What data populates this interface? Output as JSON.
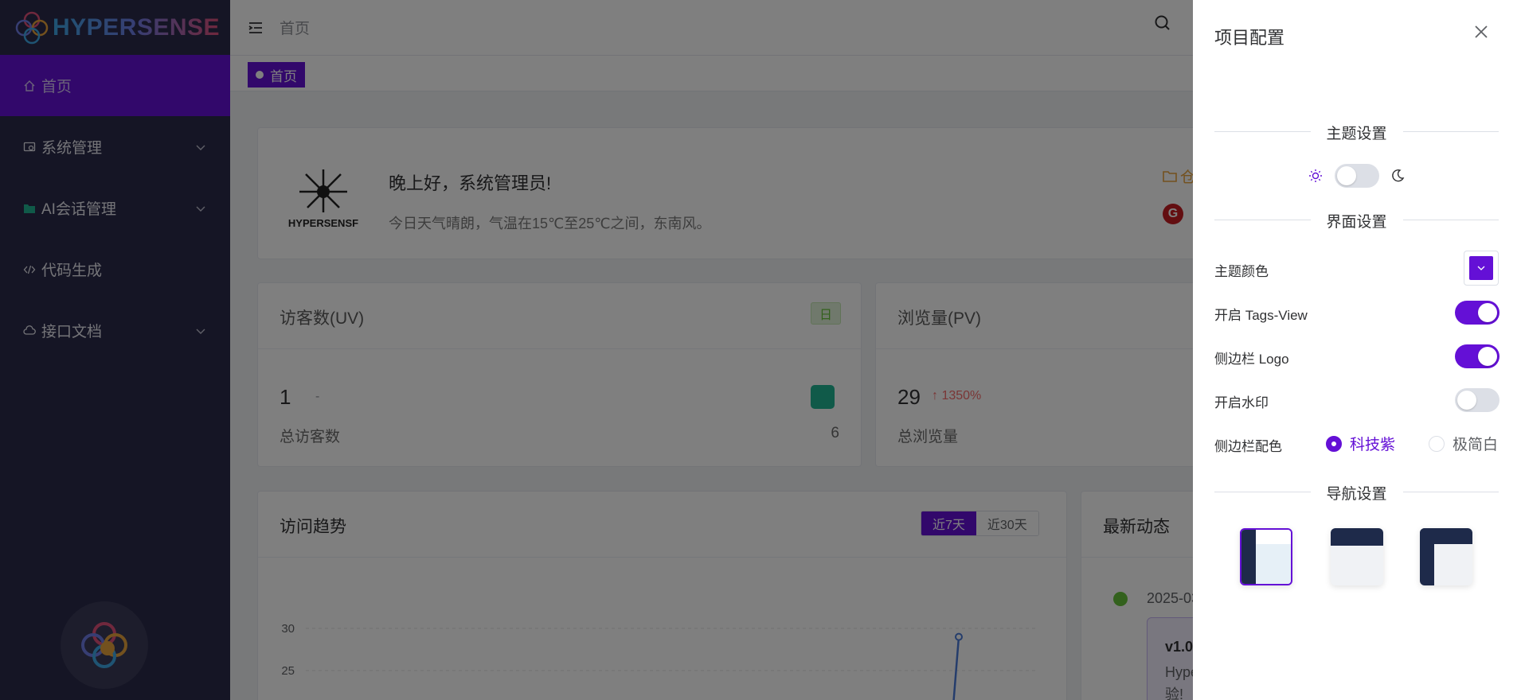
{
  "app": {
    "name": "HYPERSENSE"
  },
  "sidebar": {
    "items": [
      {
        "label": "首页"
      },
      {
        "label": "系统管理"
      },
      {
        "label": "AI会话管理"
      },
      {
        "label": "代码生成"
      },
      {
        "label": "接口文档"
      }
    ]
  },
  "header": {
    "breadcrumb": "首页"
  },
  "tags": [
    {
      "label": "首页"
    }
  ],
  "welcome": {
    "greeting": "晚上好，系统管理员!",
    "weather": "今日天气晴朗，气温在15℃至25℃之间，东南风。",
    "link1": "仓",
    "gitee": "G",
    "avatar_text": "HYPERSENSF"
  },
  "stats": {
    "uv": {
      "title": "访客数(UV)",
      "badge": "日",
      "value": "1",
      "change": "-",
      "label": "总访客数",
      "total": "6"
    },
    "pv": {
      "title": "浏览量(PV)",
      "value": "29",
      "change": "↑ 1350%",
      "label": "总浏览量"
    }
  },
  "trend": {
    "title": "访问趋势",
    "tabs": [
      {
        "label": "近7天"
      },
      {
        "label": "近30天"
      }
    ]
  },
  "chart_data": {
    "type": "line",
    "title": "访问趋势",
    "xlabel": "",
    "ylabel": "",
    "y_ticks": [
      30,
      25
    ],
    "visible_points": [
      {
        "y": 29
      }
    ]
  },
  "news": {
    "title": "最新动态",
    "date": "2025-03",
    "version": "v1.0",
    "text1": "Hype",
    "text2": "验!"
  },
  "drawer": {
    "title": "项目配置",
    "theme_section": "主题设置",
    "ui_section": "界面设置",
    "nav_section": "导航设置",
    "theme_color_label": "主题颜色",
    "tags_view_label": "开启 Tags-View",
    "sidebar_logo_label": "侧边栏 Logo",
    "watermark_label": "开启水印",
    "sidebar_color_label": "侧边栏配色",
    "sidebar_color_options": [
      {
        "label": "科技紫"
      },
      {
        "label": "极简白"
      }
    ],
    "tags_view_on": true,
    "sidebar_logo_on": true,
    "watermark_on": false,
    "dark_mode_on": false
  },
  "colors": {
    "primary": "#6410d6",
    "sidebar_bg": "#2b2b4a",
    "success": "#67c23a",
    "danger": "#f56c6c"
  }
}
